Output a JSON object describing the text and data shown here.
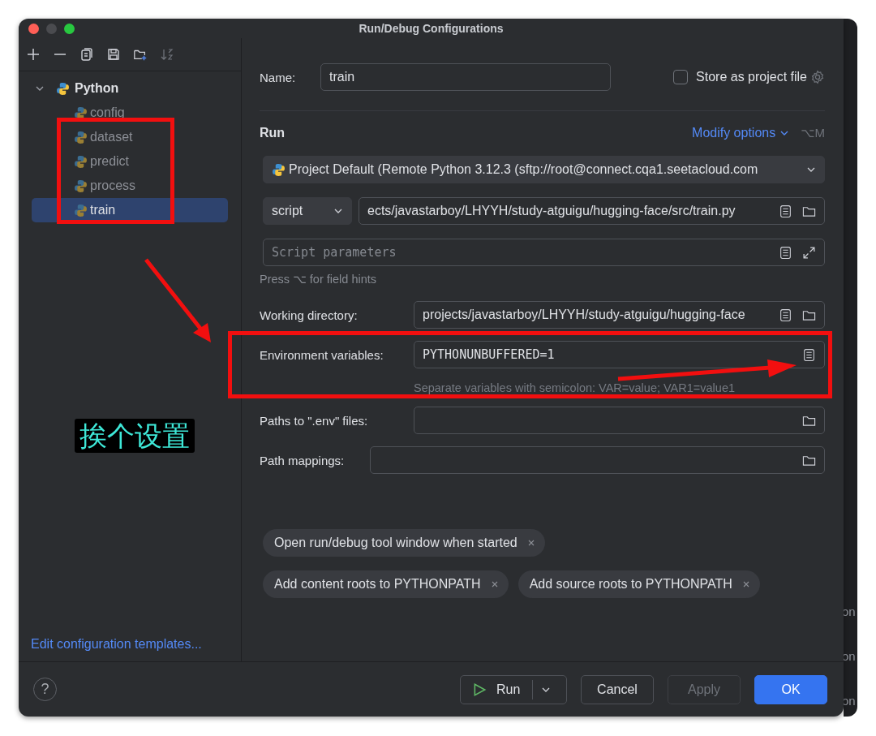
{
  "window": {
    "title": "Run/Debug Configurations"
  },
  "sidebar": {
    "tree": [
      {
        "label": "Python",
        "expanded": true,
        "children": [
          {
            "label": "config",
            "selected": false
          },
          {
            "label": "dataset",
            "selected": false
          },
          {
            "label": "predict",
            "selected": false
          },
          {
            "label": "process",
            "selected": false
          },
          {
            "label": "train",
            "selected": true
          }
        ]
      }
    ],
    "footer_link": "Edit configuration templates..."
  },
  "form": {
    "name_label": "Name:",
    "name_value": "train",
    "store_label": "Store as project file",
    "store_checked": false,
    "section": "Run",
    "modify_options": "Modify options",
    "shortcut": "⌥M",
    "interpreter": "Project Default (Remote Python 3.12.3 (sftp://root@connect.cqa1.seetacloud.com",
    "script_type": "script",
    "script_path": "ects/javastarboy/LHYYH/study-atguigu/hugging-face/src/train.py",
    "params_placeholder": "Script parameters",
    "hint": "Press ⌥ for field hints",
    "fields": [
      {
        "kind": "path",
        "label": "Working directory:",
        "value": "projects/javastarboy/LHYYH/study-atguigu/hugging-face",
        "wide_label": true
      },
      {
        "kind": "env",
        "label": "Environment variables:",
        "value": "PYTHONUNBUFFERED=1",
        "wide_label": true,
        "hint": "Separate variables with semicolon: VAR=value; VAR1=value1"
      },
      {
        "kind": "file",
        "label": "Paths to \".env\" files:",
        "wide_label": true
      },
      {
        "kind": "file",
        "label": "Path mappings:",
        "wide_label": false
      }
    ]
  },
  "chips": [
    [
      "Open run/debug tool window when started"
    ],
    [
      "Add content roots to PYTHONPATH",
      "Add source roots to PYTHONPATH"
    ]
  ],
  "buttons": [
    {
      "kind": "run",
      "label": "Run",
      "disabled": false
    },
    {
      "kind": "plain",
      "label": "Cancel",
      "disabled": false
    },
    {
      "kind": "plain",
      "label": "Apply",
      "disabled": true
    },
    {
      "kind": "primary",
      "label": "OK",
      "disabled": false
    }
  ],
  "help": "?",
  "annotation": {
    "label": "挨个设置"
  },
  "background_window": {
    "texts": [
      "on",
      "on",
      "on"
    ]
  }
}
